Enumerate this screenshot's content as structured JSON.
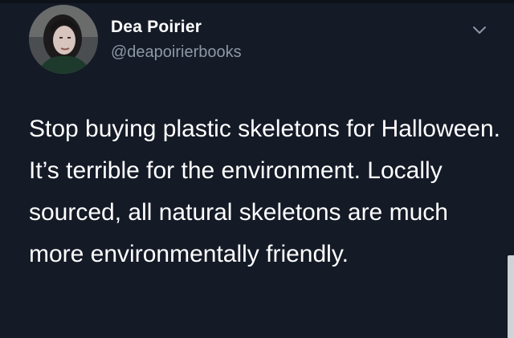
{
  "author": {
    "display_name": "Dea Poirier",
    "handle": "@deapoirierbooks"
  },
  "tweet": {
    "text": "Stop buying plastic skeletons for Halloween. It’s terrible for the environment. Locally sourced, all natural skeletons are much more environmentally friendly."
  },
  "icons": {
    "avatar": "profile-photo",
    "menu": "chevron-down-icon"
  },
  "colors": {
    "background": "#141a26",
    "text": "#ffffff",
    "secondary_text": "#8b98a5"
  }
}
